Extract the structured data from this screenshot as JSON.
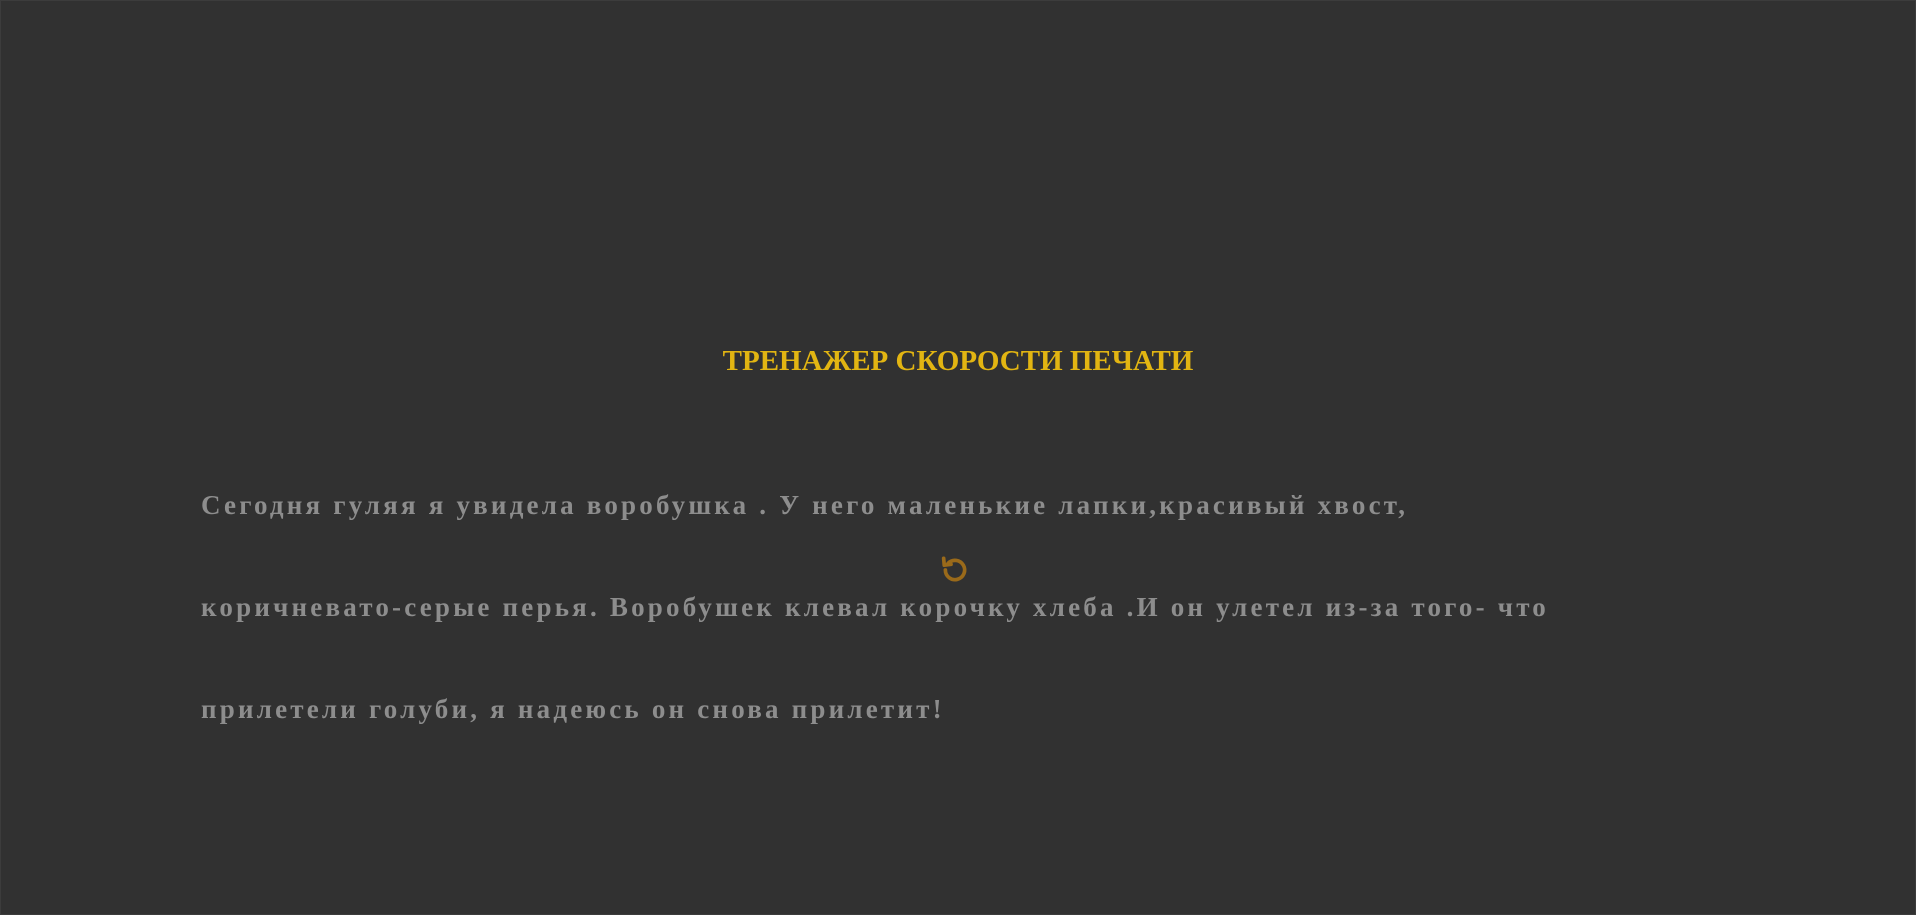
{
  "app": {
    "title": "ТРЕНАЖЕР СКОРОСТИ ПЕЧАТИ"
  },
  "text": {
    "lines": [
      "Сегодня гуляя я увидела воробушка . У него маленькие лапки,красивый хвост,",
      "коричневато-серые перья. Воробушек клевал корочку хлеба .И он улетел из-за того- что",
      "прилетели голуби, я надеюсь он снова прилетит!"
    ]
  },
  "controls": {
    "restart_icon": "restart-icon"
  },
  "colors": {
    "background": "#313131",
    "title": "#e2b512",
    "text": "#8d8d8d",
    "icon": "#9a6a1a"
  }
}
